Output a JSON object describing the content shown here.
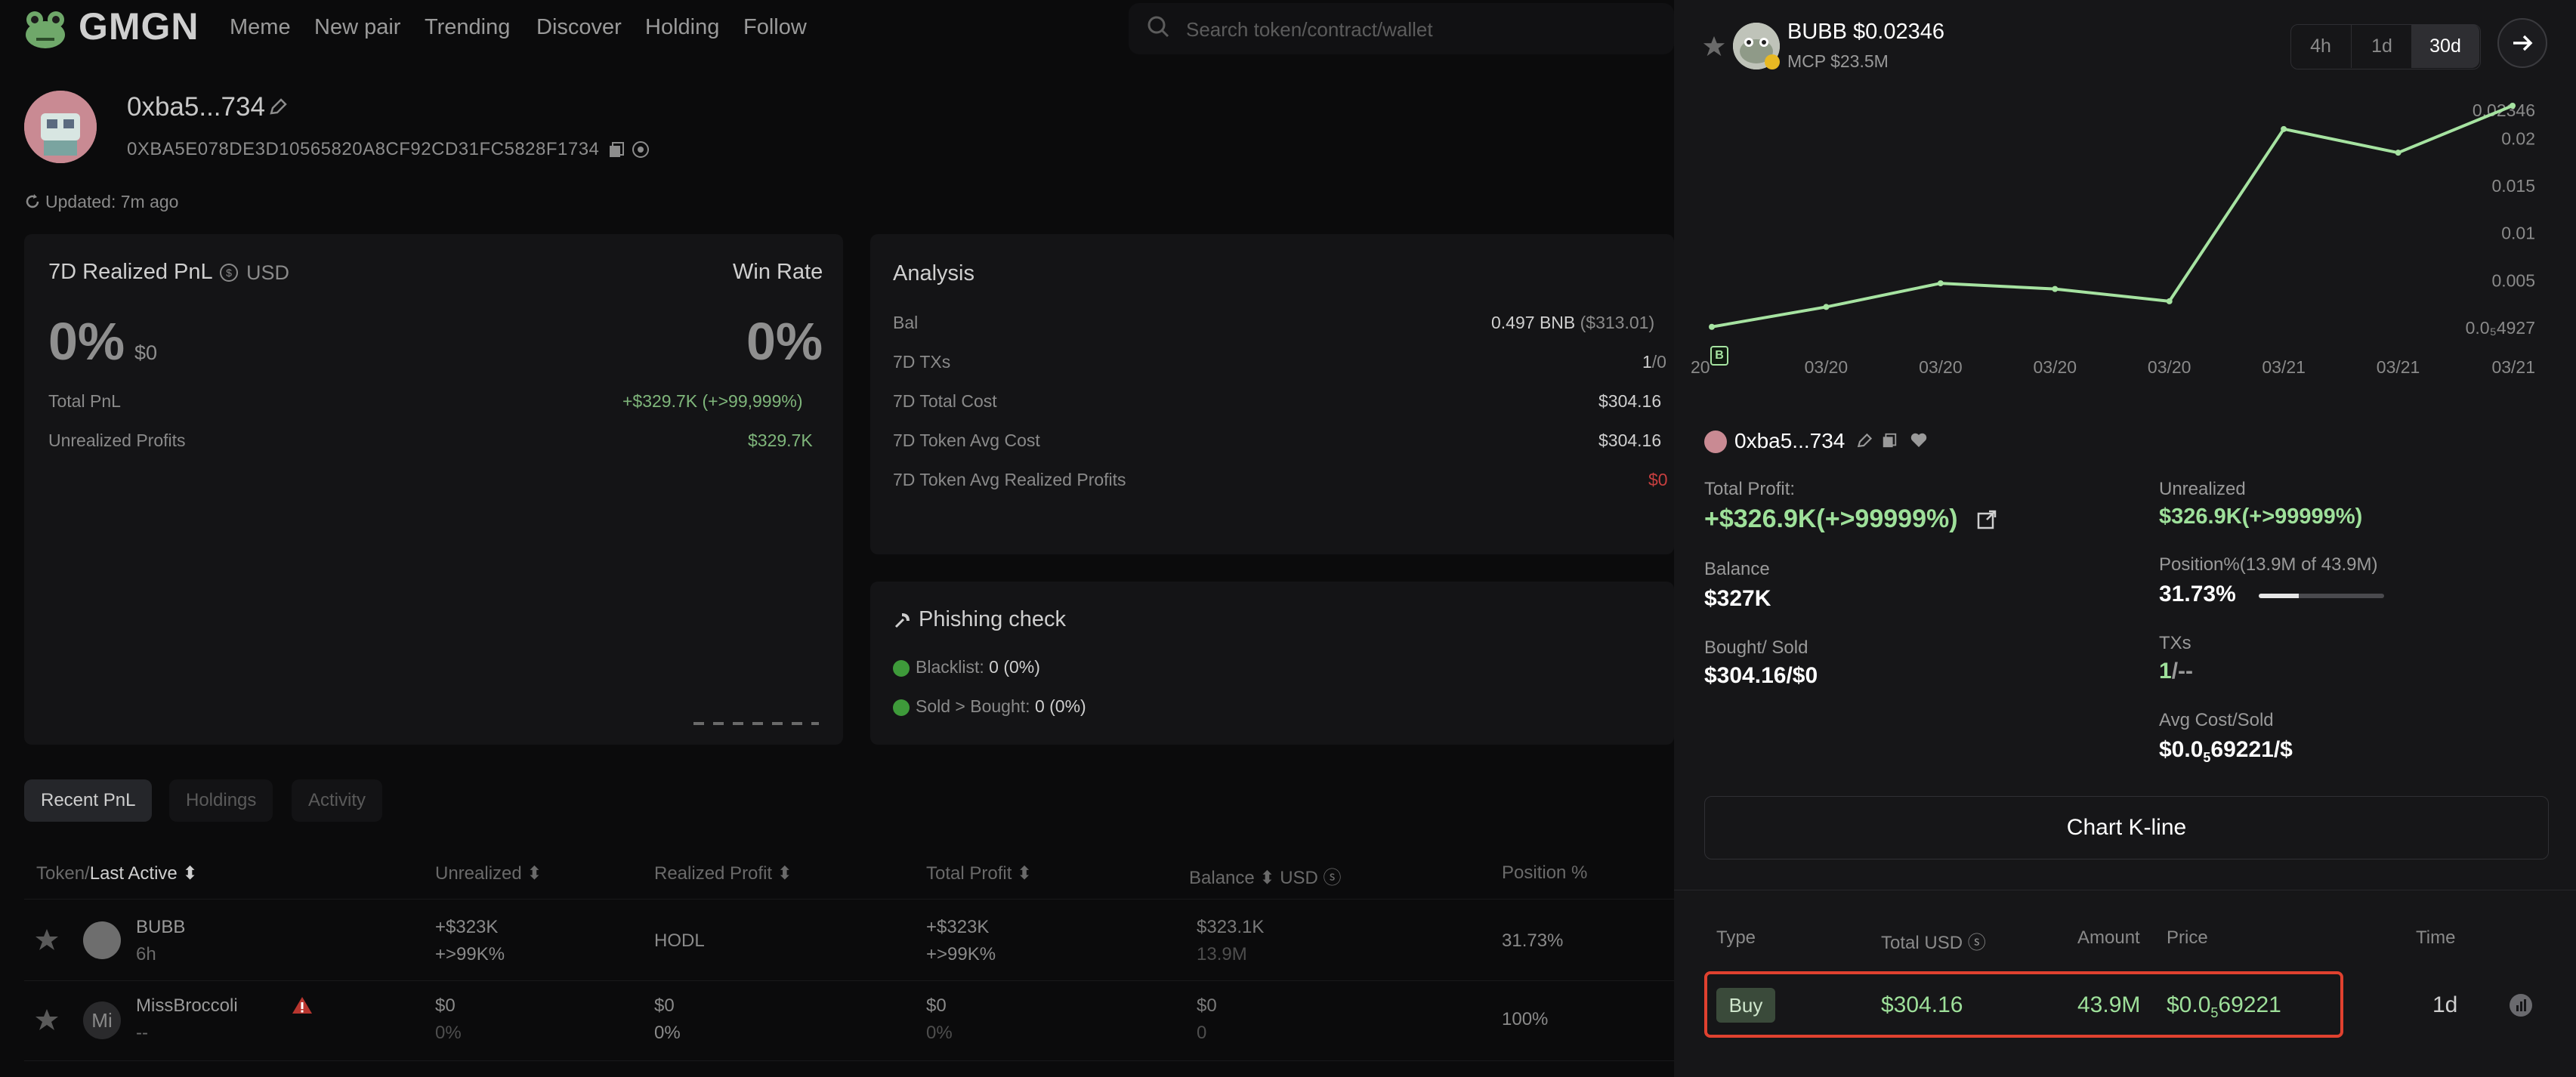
{
  "nav": {
    "logo_text": "GMGN",
    "items": [
      "Meme",
      "New pair",
      "Trending",
      "Discover",
      "Holding",
      "Follow"
    ],
    "search_placeholder": "Search token/contract/wallet"
  },
  "wallet": {
    "name": "0xba5...734",
    "address": "0XBA5E078DE3D10565820A8CF92CD31FC5828F1734",
    "updated": "Updated: 7m ago"
  },
  "pnl_card": {
    "title": "7D Realized PnL",
    "currency": "USD",
    "win_rate_label": "Win Rate",
    "pnl_pct": "0%",
    "pnl_usd": "$0",
    "win_rate": "0%",
    "total_pnl_label": "Total PnL",
    "total_pnl": "+$329.7K (+>99,999%)",
    "unrealized_label": "Unrealized Profits",
    "unrealized": "$329.7K"
  },
  "analysis": {
    "title": "Analysis",
    "rows": [
      {
        "label": "Bal",
        "value": "0.497 BNB",
        "sub": "($313.01)"
      },
      {
        "label": "7D TXs",
        "value": "1",
        "sub": "/0"
      },
      {
        "label": "7D Total Cost",
        "value": "$304.16",
        "sub": ""
      },
      {
        "label": "7D Token Avg Cost",
        "value": "$304.16",
        "sub": ""
      },
      {
        "label": "7D Token Avg Realized Profits",
        "value": "$0",
        "sub": ""
      }
    ]
  },
  "phishing": {
    "title": "Phishing check",
    "blacklist_label": "Blacklist:",
    "blacklist_value": "0 (0%)",
    "sold_label": "Sold > Bought:",
    "sold_value": "0 (0%)"
  },
  "tabs": [
    "Recent PnL",
    "Holdings",
    "Activity"
  ],
  "table": {
    "headers": {
      "token": "Token/",
      "last_active": "Last Active",
      "unrealized": "Unrealized",
      "realized": "Realized Profit",
      "total": "Total Profit",
      "balance": "Balance",
      "usd": "USD",
      "position": "Position %"
    },
    "rows": [
      {
        "name": "BUBB",
        "time": "6h",
        "unreal": "+$323K",
        "unreal_sub": "+>99K%",
        "realized": "HODL",
        "realized_sub": "",
        "total": "+$323K",
        "total_sub": "+>99K%",
        "balance": "$323.1K",
        "balance_sub": "13.9M",
        "position": "31.73%"
      },
      {
        "name": "MissBroccoli",
        "time": "--",
        "unreal": "$0",
        "unreal_sub": "0%",
        "realized": "$0",
        "realized_sub": "0%",
        "total": "$0",
        "total_sub": "0%",
        "balance": "$0",
        "balance_sub": "0",
        "position": "100%"
      }
    ]
  },
  "panel": {
    "token": "BUBB",
    "price": "$0.02346",
    "mcp": "MCP $23.5M",
    "timeframes": [
      "4h",
      "1d",
      "30d"
    ],
    "active_timeframe": "30d",
    "wallet": "0xba5...734",
    "total_profit_label": "Total Profit:",
    "total_profit": "+$326.9K(+>99999%)",
    "unrealized_label": "Unrealized",
    "unrealized": "$326.9K(+>99999%)",
    "balance_label": "Balance",
    "balance": "$327K",
    "position_label": "Position%(13.9M of 43.9M)",
    "position": "31.73%",
    "position_fraction": 0.3173,
    "bought_label": "Bought/ Sold",
    "bought": "$304.16/$0",
    "txs_label": "TXs",
    "txs_buy": "1",
    "txs_sell": "/--",
    "avgcost_label": "Avg Cost/Sold",
    "avgcost_pre": "$0.0",
    "avgcost_sub": "5",
    "avgcost_post": "69221/$",
    "kline_button": "Chart K-line",
    "trade_headers": {
      "type": "Type",
      "total": "Total",
      "usd": "USD",
      "amount": "Amount",
      "price": "Price",
      "time": "Time"
    },
    "trade": {
      "type": "Buy",
      "total": "$304.16",
      "amount": "43.9M",
      "price_pre": "$0.0",
      "price_sub": "5",
      "price_post": "69221",
      "time": "1d"
    }
  },
  "chart_data": {
    "type": "line",
    "x": [
      "20",
      "03/20",
      "03/20",
      "03/20",
      "03/20",
      "03/21",
      "03/21",
      "03/21"
    ],
    "values": [
      0.0001,
      0.0022,
      0.0047,
      0.0041,
      0.0028,
      0.021,
      0.0185,
      0.02346
    ],
    "y_ticks": [
      "0.02346",
      "0.02",
      "0.015",
      "0.01",
      "0.005",
      "0.0₅4927"
    ],
    "ylim": [
      0.0,
      0.02346
    ],
    "line_color": "#a6e3a1"
  },
  "colors": {
    "accent_green": "#9ee09a",
    "loss_red": "#c63f3f",
    "highlight_red": "#e0412f"
  }
}
